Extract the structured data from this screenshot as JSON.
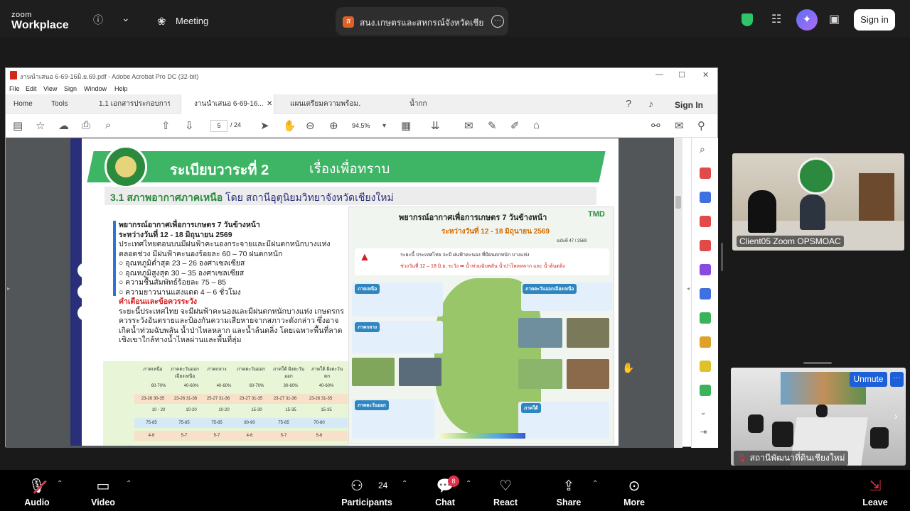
{
  "app": {
    "logo_line1": "zoom",
    "logo_line2": "Workplace",
    "meeting_label": "Meeting",
    "share_badge": "ส",
    "share_title": "สนง.เกษตรและสหกรณ์จังหวัดเชียงใหม่",
    "signin_label": "Sign in"
  },
  "acrobat": {
    "window_title": "งานนำเสนอ 6-69-16มิ.ย.69.pdf - Adobe Acrobat Pro DC (32-bit)",
    "menu": [
      "File",
      "Edit",
      "View",
      "Sign",
      "Window",
      "Help"
    ],
    "tabs": [
      {
        "label": "Home"
      },
      {
        "label": "Tools"
      },
      {
        "label": "1.1 เอกสารประกอบการ..."
      },
      {
        "label": "งานนำเสนอ 6-69-16..."
      },
      {
        "label": "แผนเตรียมความพร้อม..."
      },
      {
        "label": "น้ำกก"
      }
    ],
    "sign_in": "Sign In",
    "page_current": "5",
    "page_total": "/ 24",
    "zoom": "94.5%"
  },
  "slide": {
    "banner_title": "ระเบียบวาระที่ 2",
    "banner_sub": "เรื่องเพื่อทราบ",
    "subhead_main": "3.1 สภาพอากาศภาคเหนือ",
    "subhead_by": "โดย สถานีอุตุนิยมวิทยาจังหวัดเชียงใหม่",
    "forecast_heading": "พยากรณ์อากาศเพื่อการเกษตร 7 วันข้างหน้า",
    "forecast_dates": "ระหว่างวันที่ 12 - 18 มิถุนายน 2569",
    "forecast_p1": "ประเทศไทยตอนบนมีฝนฟ้าคะนองกระจายและมีฝนตกหนักบางแห่ง ตลอดช่วง มีฝนฟ้าคะนองร้อยละ 60 – 70 ฝนตกหนัก",
    "forecast_items": [
      "อุณหภูมิต่ำสุด 23 – 26 องศาเซลเซียส",
      "อุณหภูมิสูงสุด 30 – 35 องศาเซลเซียส",
      "ความชื้นสัมพัทธ์ร้อยละ 75 – 85",
      "ความยาวนานแสงแดด 4 – 6 ชั่วโมง"
    ],
    "warning_heading": "คำเตือนและข้อควรระวัง",
    "warning_text": "ระยะนี้ประเทศไทย จะมีฝนฟ้าคะนองและมีฝนตกหนักบางแห่ง เกษตรกรควรระวังอันตรายและป้องกันความเสียหายจากสภาวะดังกล่าว ซึ่งอาจเกิดน้ำท่วมฉับพลัน น้ำป่าไหลหลาก และน้ำล้นตลิ่ง โดยเฉพาะพื้นที่ลาดเชิงเขาใกล้ทางน้ำไหลผ่านและพื้นที่ลุ่ม",
    "table_headers": [
      "ภาคเหนือ",
      "ภาคตะวันออกเฉียงเหนือ",
      "ภาคกลาง",
      "ภาคตะวันออก",
      "ภาคใต้ ฝั่งตะวันออก",
      "ภาคใต้ ฝั่งตะวันตก"
    ],
    "table_rain": [
      "60-70%",
      "40-60%",
      "40-60%",
      "60-70%",
      "30-60%",
      "40-60%"
    ],
    "table_temp": [
      "23-26 30-35",
      "23-26 31-36",
      "25-27 31-36",
      "23-27 31-35",
      "23-27 31-36",
      "23-26 31-35"
    ],
    "table_wind": [
      "10 - 20",
      "10-20",
      "10-20",
      "15-30",
      "15-35",
      "15-35"
    ],
    "table_humid": [
      "75-85",
      "75-85",
      "75-85",
      "80-90",
      "75-85",
      "70-80"
    ],
    "table_sun": [
      "4-6",
      "5-7",
      "5-7",
      "4-6",
      "5-7",
      "5-6"
    ],
    "infog_title": "พยากรณ์อากาศเพื่อการเกษตร 7 วันข้างหน้า",
    "infog_dates": "ระหว่างวันที่ 12 - 18 มิถุนายน 2569",
    "infog_number": "ฉบับที่ 47 / 2569",
    "infog_tmd": "TMD",
    "alert_line1": "ระยะนี้ ประเทศไทย จะมี ฝนฟ้าคะนอง ที่มีฝนตกหนัก บางแห่ง",
    "alert_line2": "ช่วงวันที่ 12 – 18 มิ.ย. ระวัง ➡ น้ำท่วมฉับพลัน น้ำป่าไหลหลาก และ น้ำล้นตลิ่ง",
    "region_north": "ภาคเหนือ",
    "region_northeast": "ภาคตะวันออกเฉียงเหนือ",
    "region_central": "ภาคกลาง",
    "region_east": "ภาคตะวันออก",
    "region_south": "ภาคใต้"
  },
  "participants": {
    "tile1_name": "Client05 Zoom OPSMOAC",
    "tile2_name": "สถานีพัฒนาที่ดินเชียงใหม่",
    "unmute_label": "Unmute",
    "tile_more": "···"
  },
  "controls": {
    "audio": "Audio",
    "video": "Video",
    "participants": "Participants",
    "participants_count": "24",
    "chat": "Chat",
    "chat_badge": "8",
    "react": "React",
    "share": "Share",
    "more": "More",
    "leave": "Leave"
  },
  "colors": {
    "zoom_bg": "#1e1e1e",
    "unmute_blue": "#1d5fd8",
    "banner_green": "#3db564",
    "slide_navy": "#2a2f7a",
    "alert_red": "#d42020"
  }
}
